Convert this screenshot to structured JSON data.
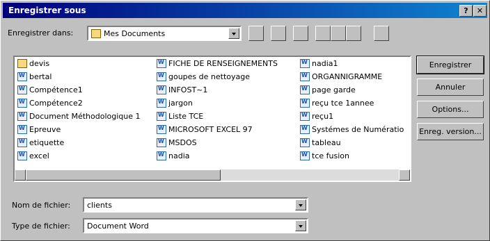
{
  "window": {
    "title": "Enregistrer sous",
    "help_label": "?",
    "close_label": "✕"
  },
  "location": {
    "label": "Enregistrer dans:",
    "value": "Mes Documents"
  },
  "toolbar": [
    "up-folder",
    "desktop",
    "new-folder",
    "list-view",
    "details-view",
    "properties-view",
    "commands"
  ],
  "files": {
    "col1": [
      "devis",
      "bertal",
      "Compétence1",
      "Compétence2",
      "Document Méthodologique 1",
      "Epreuve",
      "etiquette",
      "excel"
    ],
    "col2": [
      "FICHE DE RENSEIGNEMENTS",
      "goupes de nettoyage",
      "INFOST~1",
      "jargon",
      "Liste TCE",
      "MICROSOFT EXCEL 97",
      "MSDOS",
      "nadia"
    ],
    "col3": [
      "nadia1",
      "ORGANNIGRAMME",
      "page garde",
      "reçu tce 1annee",
      "reçu1",
      "Systémes de Numératio",
      "tableau",
      "tce fusion"
    ]
  },
  "filename": {
    "label": "Nom de fichier:",
    "value": "clients"
  },
  "filetype": {
    "label": "Type de fichier:",
    "value": "Document Word"
  },
  "buttons": {
    "save": "Enregistrer",
    "cancel": "Annuler",
    "options": "Options...",
    "version": "Enreg. version..."
  }
}
